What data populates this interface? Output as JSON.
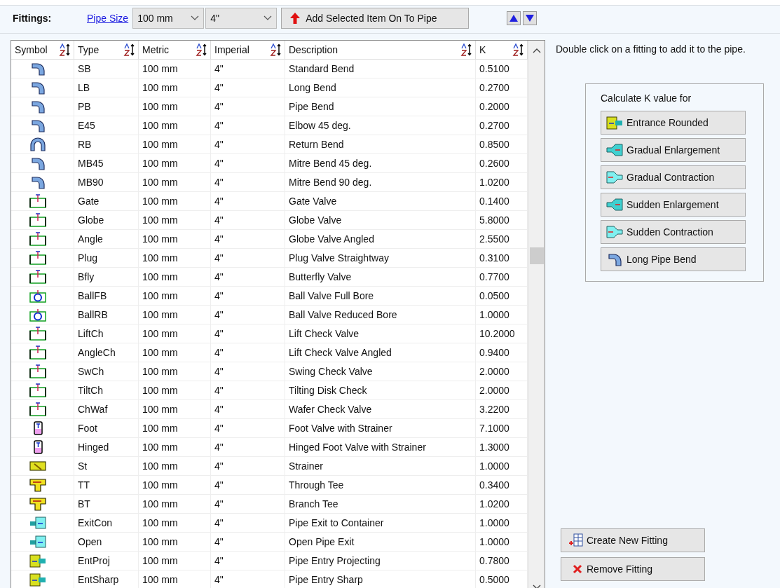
{
  "toolbar": {
    "label": "Fittings:",
    "pipe_size_link": "Pipe Size",
    "metric_select": {
      "value": "100 mm"
    },
    "imperial_select": {
      "value": "4\""
    },
    "add_button": "Add Selected Item On To Pipe"
  },
  "table": {
    "columns": [
      "Symbol",
      "Type",
      "Metric",
      "Imperial",
      "Description",
      "K"
    ],
    "rows": [
      {
        "kind": "bend",
        "type": "SB",
        "metric": "100 mm",
        "imperial": "4\"",
        "description": "Standard Bend",
        "k": "0.5100"
      },
      {
        "kind": "bend",
        "type": "LB",
        "metric": "100 mm",
        "imperial": "4\"",
        "description": "Long Bend",
        "k": "0.2700"
      },
      {
        "kind": "bend",
        "type": "PB",
        "metric": "100 mm",
        "imperial": "4\"",
        "description": "Pipe Bend",
        "k": "0.2000"
      },
      {
        "kind": "bend",
        "type": "E45",
        "metric": "100 mm",
        "imperial": "4\"",
        "description": "Elbow 45 deg.",
        "k": "0.2700"
      },
      {
        "kind": "return",
        "type": "RB",
        "metric": "100 mm",
        "imperial": "4\"",
        "description": "Return Bend",
        "k": "0.8500"
      },
      {
        "kind": "bend",
        "type": "MB45",
        "metric": "100 mm",
        "imperial": "4\"",
        "description": "Mitre Bend 45 deg.",
        "k": "0.2600"
      },
      {
        "kind": "bend",
        "type": "MB90",
        "metric": "100 mm",
        "imperial": "4\"",
        "description": "Mitre Bend 90 deg.",
        "k": "1.0200"
      },
      {
        "kind": "valve",
        "type": "Gate",
        "metric": "100 mm",
        "imperial": "4\"",
        "description": "Gate Valve",
        "k": "0.1400"
      },
      {
        "kind": "valve",
        "type": "Globe",
        "metric": "100 mm",
        "imperial": "4\"",
        "description": "Globe Valve",
        "k": "5.8000"
      },
      {
        "kind": "valve",
        "type": "Angle",
        "metric": "100 mm",
        "imperial": "4\"",
        "description": "Globe Valve Angled",
        "k": "2.5500"
      },
      {
        "kind": "valve",
        "type": "Plug",
        "metric": "100 mm",
        "imperial": "4\"",
        "description": "Plug Valve Straightway",
        "k": "0.3100"
      },
      {
        "kind": "valve",
        "type": "Bfly",
        "metric": "100 mm",
        "imperial": "4\"",
        "description": "Butterfly Valve",
        "k": "0.7700"
      },
      {
        "kind": "ball",
        "type": "BallFB",
        "metric": "100 mm",
        "imperial": "4\"",
        "description": "Ball Valve Full Bore",
        "k": "0.0500"
      },
      {
        "kind": "ball",
        "type": "BallRB",
        "metric": "100 mm",
        "imperial": "4\"",
        "description": "Ball Valve Reduced Bore",
        "k": "1.0000"
      },
      {
        "kind": "valve",
        "type": "LiftCh",
        "metric": "100 mm",
        "imperial": "4\"",
        "description": "Lift Check Valve",
        "k": "10.2000"
      },
      {
        "kind": "valve",
        "type": "AngleCh",
        "metric": "100 mm",
        "imperial": "4\"",
        "description": "Lift Check Valve Angled",
        "k": "0.9400"
      },
      {
        "kind": "valve",
        "type": "SwCh",
        "metric": "100 mm",
        "imperial": "4\"",
        "description": "Swing Check Valve",
        "k": "2.0000"
      },
      {
        "kind": "valve",
        "type": "TiltCh",
        "metric": "100 mm",
        "imperial": "4\"",
        "description": "Tilting Disk Check",
        "k": "2.0000"
      },
      {
        "kind": "valve",
        "type": "ChWaf",
        "metric": "100 mm",
        "imperial": "4\"",
        "description": "Wafer Check Valve",
        "k": "3.2200"
      },
      {
        "kind": "foot",
        "type": "Foot",
        "metric": "100 mm",
        "imperial": "4\"",
        "description": "Foot Valve with Strainer",
        "k": "7.1000"
      },
      {
        "kind": "foot",
        "type": "Hinged",
        "metric": "100 mm",
        "imperial": "4\"",
        "description": "Hinged Foot Valve with Strainer",
        "k": "1.3000"
      },
      {
        "kind": "strainer",
        "type": "St",
        "metric": "100 mm",
        "imperial": "4\"",
        "description": "Strainer",
        "k": "1.0000"
      },
      {
        "kind": "tee",
        "type": "TT",
        "metric": "100 mm",
        "imperial": "4\"",
        "description": "Through Tee",
        "k": "0.3400"
      },
      {
        "kind": "tee",
        "type": "BT",
        "metric": "100 mm",
        "imperial": "4\"",
        "description": "Branch Tee",
        "k": "1.0200"
      },
      {
        "kind": "exit",
        "type": "ExitCon",
        "metric": "100 mm",
        "imperial": "4\"",
        "description": "Pipe Exit to Container",
        "k": "1.0000"
      },
      {
        "kind": "exit",
        "type": "Open",
        "metric": "100 mm",
        "imperial": "4\"",
        "description": "Open Pipe Exit",
        "k": "1.0000"
      },
      {
        "kind": "entry",
        "type": "EntProj",
        "metric": "100 mm",
        "imperial": "4\"",
        "description": "Pipe Entry Projecting",
        "k": "0.7800"
      },
      {
        "kind": "entry",
        "type": "EntSharp",
        "metric": "100 mm",
        "imperial": "4\"",
        "description": "Pipe Entry Sharp",
        "k": "0.5000"
      }
    ]
  },
  "hint": "Double click on a fitting to add it to the pipe.",
  "calculate_group": {
    "title": "Calculate K value for",
    "buttons": [
      {
        "kind": "entry",
        "label": "Entrance Rounded"
      },
      {
        "kind": "enlarge",
        "label": "Gradual Enlargement"
      },
      {
        "kind": "contract",
        "label": "Gradual Contraction"
      },
      {
        "kind": "enlarge",
        "label": "Sudden Enlargement"
      },
      {
        "kind": "contract",
        "label": "Sudden Contraction"
      },
      {
        "kind": "bend",
        "label": "Long Pipe Bend"
      }
    ]
  },
  "create_button": "Create New Fitting",
  "remove_button": "Remove Fitting"
}
